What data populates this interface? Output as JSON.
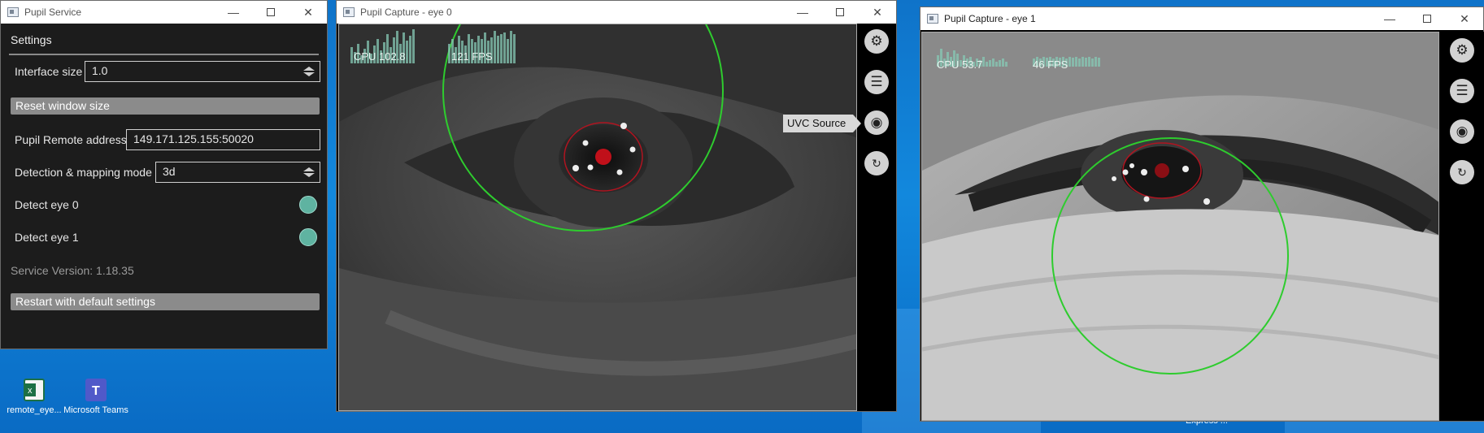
{
  "desktop": {
    "icons": [
      {
        "label": "remote_eye...",
        "icon": "excel-file-icon",
        "color": "#1d7045"
      },
      {
        "label": "Microsoft Teams",
        "icon": "teams-icon",
        "color": "#5059c9"
      }
    ],
    "partial_captions": [
      "...",
      "Express ..."
    ]
  },
  "service_window": {
    "title": "Pupil Service",
    "settings_title": "Settings",
    "interface_size": {
      "label": "Interface size",
      "value": "1.0"
    },
    "reset_button": "Reset window size",
    "remote_address": {
      "label": "Pupil Remote address",
      "value": "149.171.125.155:50020"
    },
    "detection_mode": {
      "label": "Detection & mapping mode",
      "value": "3d"
    },
    "detect_eye0": {
      "label": "Detect eye 0",
      "on": true
    },
    "detect_eye1": {
      "label": "Detect eye 1",
      "on": true
    },
    "version": "Service Version: 1.18.35",
    "restart_button": "Restart with default settings",
    "accent_color": "#5fb3a1"
  },
  "eye0_window": {
    "title": "Pupil Capture - eye 0",
    "cpu": "CPU 102.8",
    "fps": "121 FPS",
    "tooltip": "UVC Source",
    "sidebar_icons": [
      "gear-icon",
      "sliders-icon",
      "camera-icon",
      "rotate-3d-icon"
    ]
  },
  "eye1_window": {
    "title": "Pupil Capture - eye 1",
    "cpu": "CPU 53.7",
    "fps": "46 FPS",
    "sidebar_icons": [
      "gear-icon",
      "sliders-icon",
      "camera-icon",
      "rotate-3d-icon"
    ]
  },
  "colors": {
    "model_circle": "#2ecc2e",
    "pupil_center": "#c0101a",
    "pupil_outline": "#b01420"
  }
}
